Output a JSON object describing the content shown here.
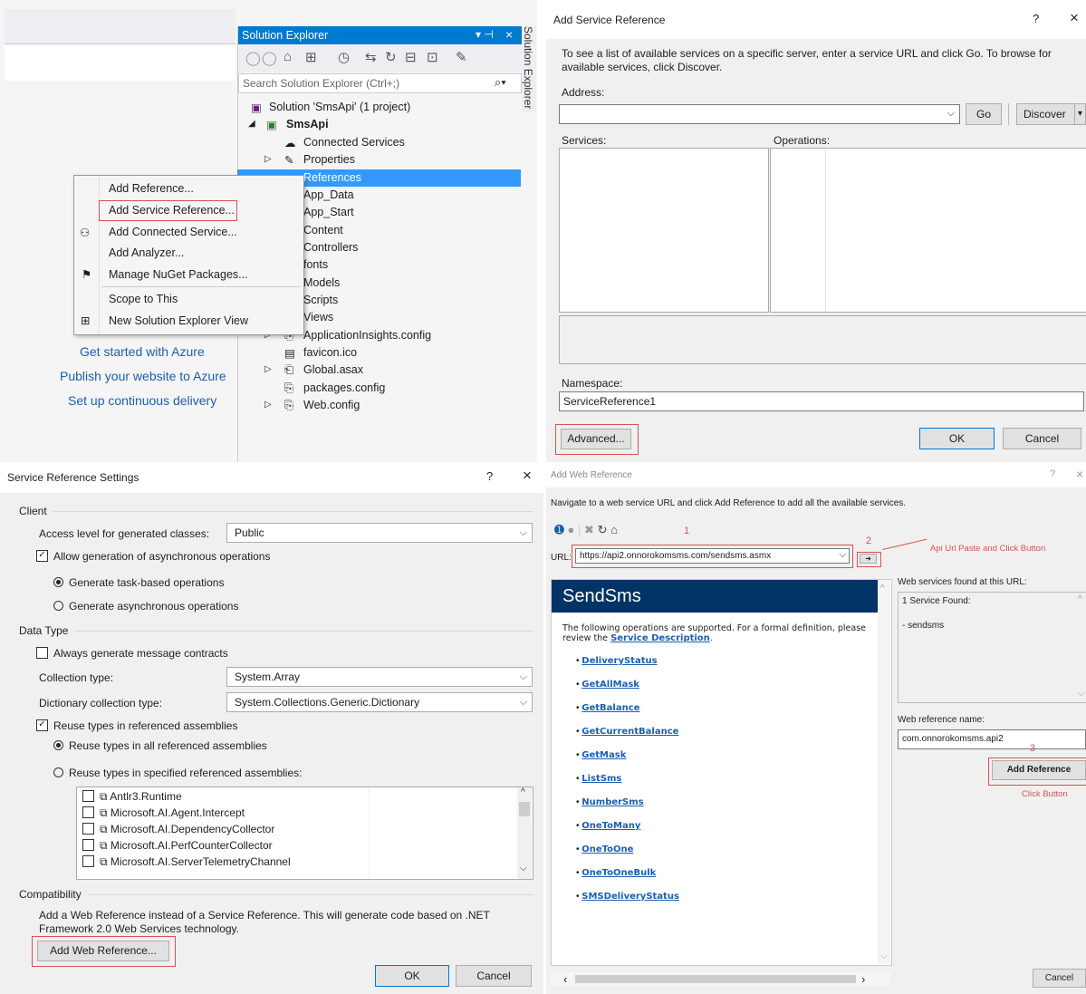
{
  "solution_explorer": {
    "title": "Solution Explorer",
    "side_tab": "Solution Explorer",
    "search_placeholder": "Search Solution Explorer (Ctrl+;)",
    "tree": [
      {
        "label": "Solution 'SmsApi' (1 project)"
      },
      {
        "label": "SmsApi"
      },
      {
        "label": "Connected Services"
      },
      {
        "label": "Properties"
      },
      {
        "label": "References"
      },
      {
        "label": "App_Data"
      },
      {
        "label": "App_Start"
      },
      {
        "label": "Content"
      },
      {
        "label": "Controllers"
      },
      {
        "label": "fonts"
      },
      {
        "label": "Models"
      },
      {
        "label": "Scripts"
      },
      {
        "label": "Views"
      },
      {
        "label": "ApplicationInsights.config"
      },
      {
        "label": "favicon.ico"
      },
      {
        "label": "Global.asax"
      },
      {
        "label": "packages.config"
      },
      {
        "label": "Web.config"
      }
    ],
    "azure_links": [
      "Get started with Azure",
      "Publish your website to Azure",
      "Set up continuous delivery"
    ]
  },
  "context_menu": {
    "items": [
      "Add Reference...",
      "Add Service Reference...",
      "Add Connected Service...",
      "Add Analyzer...",
      "Manage NuGet Packages...",
      "Scope to This",
      "New Solution Explorer View"
    ]
  },
  "add_service_reference": {
    "title": "Add Service Reference",
    "help": "?",
    "close": "×",
    "instructions": "To see a list of available services on a specific server, enter a service URL and click Go. To browse for available services, click Discover.",
    "address_label": "Address:",
    "address_value": "",
    "go_label": "Go",
    "discover_label": "Discover",
    "services_label": "Services:",
    "operations_label": "Operations:",
    "namespace_label": "Namespace:",
    "namespace_value": "ServiceReference1",
    "advanced_label": "Advanced...",
    "ok_label": "OK",
    "cancel_label": "Cancel"
  },
  "service_reference_settings": {
    "title": "Service Reference Settings",
    "help": "?",
    "close": "×",
    "client_group": "Client",
    "access_level_label": "Access level for generated classes:",
    "access_level_value": "Public",
    "allow_async_label": "Allow generation of asynchronous operations",
    "task_based_label": "Generate task-based operations",
    "async_ops_label": "Generate asynchronous operations",
    "data_type_group": "Data Type",
    "always_generate_label": "Always generate message contracts",
    "collection_type_label": "Collection type:",
    "collection_type_value": "System.Array",
    "dictionary_type_label": "Dictionary collection type:",
    "dictionary_type_value": "System.Collections.Generic.Dictionary",
    "reuse_types_label": "Reuse types in referenced assemblies",
    "reuse_all_label": "Reuse types in all referenced assemblies",
    "reuse_specified_label": "Reuse types in specified referenced assemblies:",
    "assemblies": [
      "Antlr3.Runtime",
      "Microsoft.AI.Agent.Intercept",
      "Microsoft.AI.DependencyCollector",
      "Microsoft.AI.PerfCounterCollector",
      "Microsoft.AI.ServerTelemetryChannel"
    ],
    "compat_group": "Compatibility",
    "compat_text": "Add a Web Reference instead of a Service Reference. This will generate code based on .NET Framework 2.0 Web Services technology.",
    "add_web_ref_label": "Add Web Reference...",
    "ok_label": "OK",
    "cancel_label": "Cancel"
  },
  "add_web_reference": {
    "title": "Add Web Reference",
    "help": "?",
    "close": "×",
    "instructions": "Navigate to a web service URL and click Add Reference to add all the available services.",
    "url_label": "URL:",
    "url_value": "https://api2.onnorokomsms.com/sendsms.asmx",
    "annot_1": "1",
    "annot_2": "2",
    "annot_3": "3",
    "annot_paste": "Api Url Paste and Click Button",
    "annot_click": "Click Button",
    "page_heading": "SendSms",
    "page_intro": "The following operations are supported. For a formal definition, please review the",
    "service_description_link": "Service Description",
    "operations": [
      "DeliveryStatus",
      "GetAllMask",
      "GetBalance",
      "GetCurrentBalance",
      "GetMask",
      "ListSms",
      "NumberSms",
      "OneToMany",
      "OneToOne",
      "OneToOneBulk",
      "SMSDeliveryStatus"
    ],
    "found_label": "Web services found at this URL:",
    "found_count": "1 Service Found:",
    "found_item": "- sendsms",
    "web_ref_name_label": "Web reference name:",
    "web_ref_name_value": "com.onnorokomsms.api2",
    "add_reference_label": "Add Reference",
    "cancel_label": "Cancel"
  },
  "colors": {
    "vs_blue": "#007acc",
    "selection": "#3399ff",
    "link": "#1a5fb4",
    "annotation_red": "#d9534f",
    "page_header": "#003366"
  }
}
